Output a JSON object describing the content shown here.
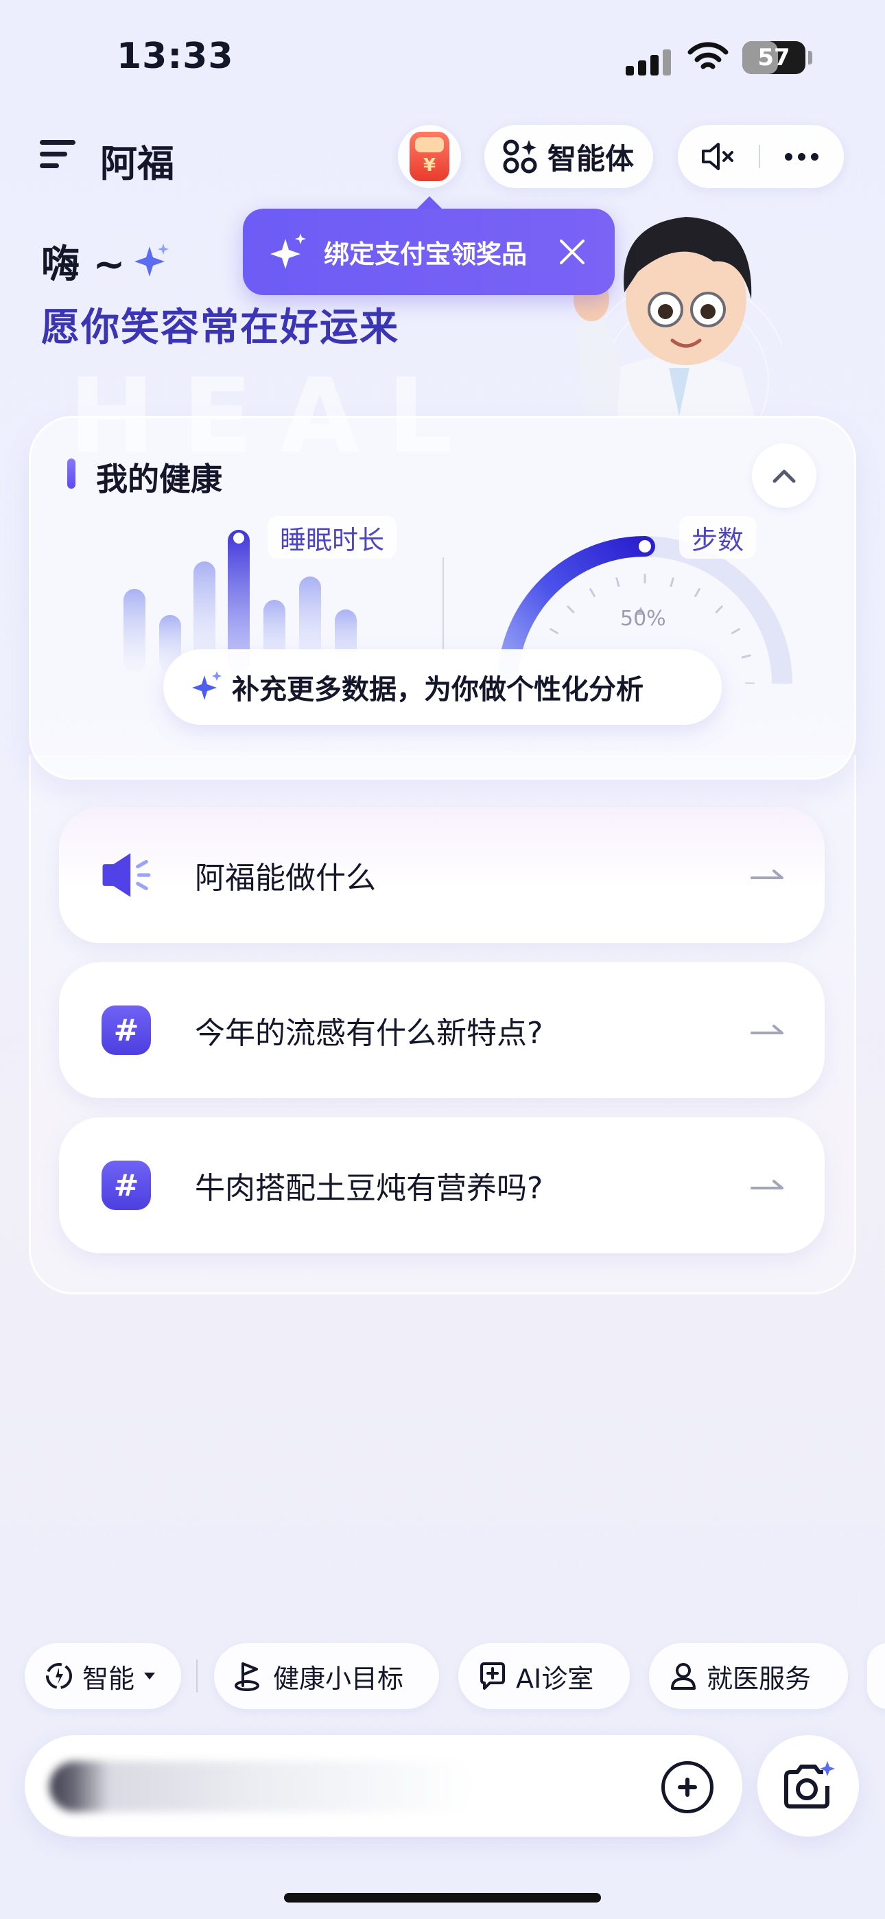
{
  "status_bar": {
    "time": "13:33",
    "battery_percent": "57",
    "battery_level": 0.57
  },
  "header": {
    "title": "阿福",
    "agent_label": "智能体"
  },
  "greeting": {
    "hi": "嗨 ~",
    "line": "愿你笑容常在好运来"
  },
  "tooltip": {
    "text": "绑定支付宝领奖品"
  },
  "health": {
    "title": "我的健康",
    "sleep_label": "睡眠时长",
    "steps_label": "步数",
    "gauge_pct": "50%",
    "gauge_value": 0.5,
    "suggest": "补充更多数据，为你做个性化分析"
  },
  "suggestions": [
    {
      "text": "阿福能做什么",
      "icon": "speaker-icon"
    },
    {
      "text": "今年的流感有什么新特点?",
      "icon": "hash-icon"
    },
    {
      "text": "牛肉搭配土豆炖有营养吗?",
      "icon": "hash-icon"
    }
  ],
  "chips": [
    {
      "label": "智能"
    },
    {
      "label": "健康小目标"
    },
    {
      "label": "AI诊室"
    },
    {
      "label": "就医服务"
    }
  ],
  "colors": {
    "accent": "#5b4cf0",
    "greeting": "#3b35b5"
  }
}
